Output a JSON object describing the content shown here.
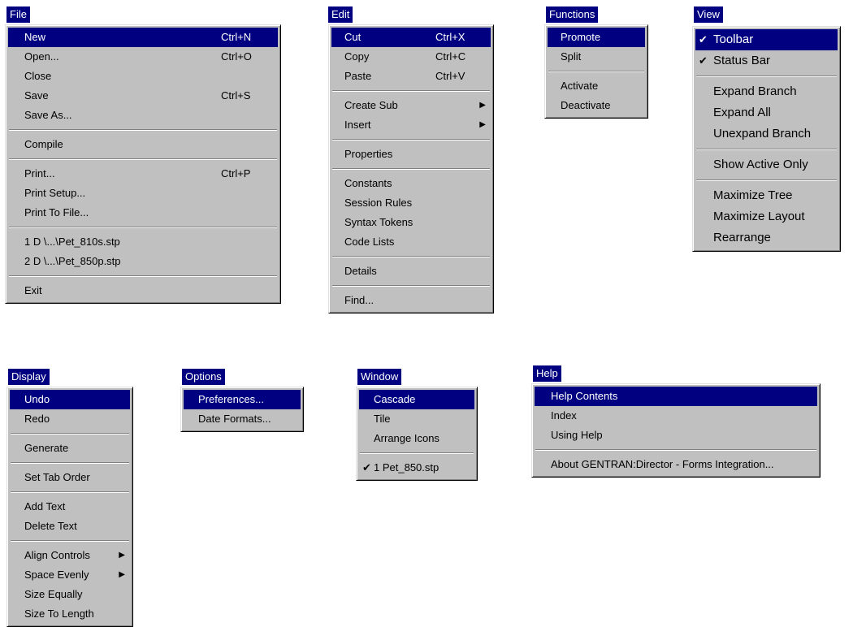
{
  "menus": {
    "file": {
      "title": "File",
      "items": [
        {
          "label": "New",
          "shortcut": "Ctrl+N",
          "selected": true
        },
        {
          "label": "Open...",
          "shortcut": "Ctrl+O"
        },
        {
          "label": "Close"
        },
        {
          "label": "Save",
          "shortcut": "Ctrl+S"
        },
        {
          "label": "Save As..."
        },
        {
          "separator": true
        },
        {
          "label": "Compile"
        },
        {
          "separator": true
        },
        {
          "label": "Print...",
          "shortcut": "Ctrl+P"
        },
        {
          "label": "Print Setup..."
        },
        {
          "label": "Print To File..."
        },
        {
          "separator": true
        },
        {
          "label": "1 D \\...\\Pet_810s.stp"
        },
        {
          "label": "2 D \\...\\Pet_850p.stp"
        },
        {
          "separator": true
        },
        {
          "label": "Exit"
        }
      ]
    },
    "edit": {
      "title": "Edit",
      "items": [
        {
          "label": "Cut",
          "shortcut": "Ctrl+X",
          "selected": true
        },
        {
          "label": "Copy",
          "shortcut": "Ctrl+C"
        },
        {
          "label": "Paste",
          "shortcut": "Ctrl+V"
        },
        {
          "separator": true
        },
        {
          "label": "Create Sub",
          "submenu": true
        },
        {
          "label": "Insert",
          "submenu": true
        },
        {
          "separator": true
        },
        {
          "label": "Properties"
        },
        {
          "separator": true
        },
        {
          "label": "Constants"
        },
        {
          "label": "Session Rules"
        },
        {
          "label": "Syntax Tokens"
        },
        {
          "label": "Code Lists"
        },
        {
          "separator": true
        },
        {
          "label": "Details"
        },
        {
          "separator": true
        },
        {
          "label": "Find..."
        }
      ]
    },
    "functions": {
      "title": "Functions",
      "items": [
        {
          "label": "Promote",
          "selected": true
        },
        {
          "label": "Split"
        },
        {
          "separator": true
        },
        {
          "label": "Activate"
        },
        {
          "label": "Deactivate"
        }
      ]
    },
    "view": {
      "title": "View",
      "items": [
        {
          "label": "Toolbar",
          "checked": true,
          "selected": true
        },
        {
          "label": "Status Bar",
          "checked": true
        },
        {
          "separator": true
        },
        {
          "label": "Expand Branch"
        },
        {
          "label": "Expand All"
        },
        {
          "label": "Unexpand Branch"
        },
        {
          "separator": true
        },
        {
          "label": "Show Active Only"
        },
        {
          "separator": true
        },
        {
          "label": "Maximize Tree"
        },
        {
          "label": "Maximize Layout"
        },
        {
          "label": "Rearrange"
        }
      ]
    },
    "display": {
      "title": "Display",
      "items": [
        {
          "label": "Undo",
          "selected": true
        },
        {
          "label": "Redo"
        },
        {
          "separator": true
        },
        {
          "label": "Generate"
        },
        {
          "separator": true
        },
        {
          "label": "Set Tab Order"
        },
        {
          "separator": true
        },
        {
          "label": "Add Text"
        },
        {
          "label": "Delete Text"
        },
        {
          "separator": true
        },
        {
          "label": "Align Controls",
          "submenu": true
        },
        {
          "label": "Space Evenly",
          "submenu": true
        },
        {
          "label": "Size Equally"
        },
        {
          "label": "Size To Length"
        }
      ]
    },
    "options": {
      "title": "Options",
      "items": [
        {
          "label": "Preferences...",
          "selected": true
        },
        {
          "label": "Date Formats..."
        }
      ]
    },
    "window": {
      "title": "Window",
      "items": [
        {
          "label": "Cascade",
          "selected": true
        },
        {
          "label": "Tile"
        },
        {
          "label": "Arrange Icons"
        },
        {
          "separator": true
        },
        {
          "label": "1 Pet_850.stp",
          "checked": true
        }
      ]
    },
    "help": {
      "title": "Help",
      "items": [
        {
          "label": "Help Contents",
          "selected": true
        },
        {
          "label": "Index"
        },
        {
          "label": "Using Help"
        },
        {
          "separator": true
        },
        {
          "label": "About GENTRAN:Director - Forms Integration..."
        }
      ]
    }
  },
  "icons": {
    "check": "✔",
    "submenu_arrow": "▶"
  },
  "colors": {
    "highlight": "#000080",
    "menu_bg": "#c0c0c0"
  }
}
